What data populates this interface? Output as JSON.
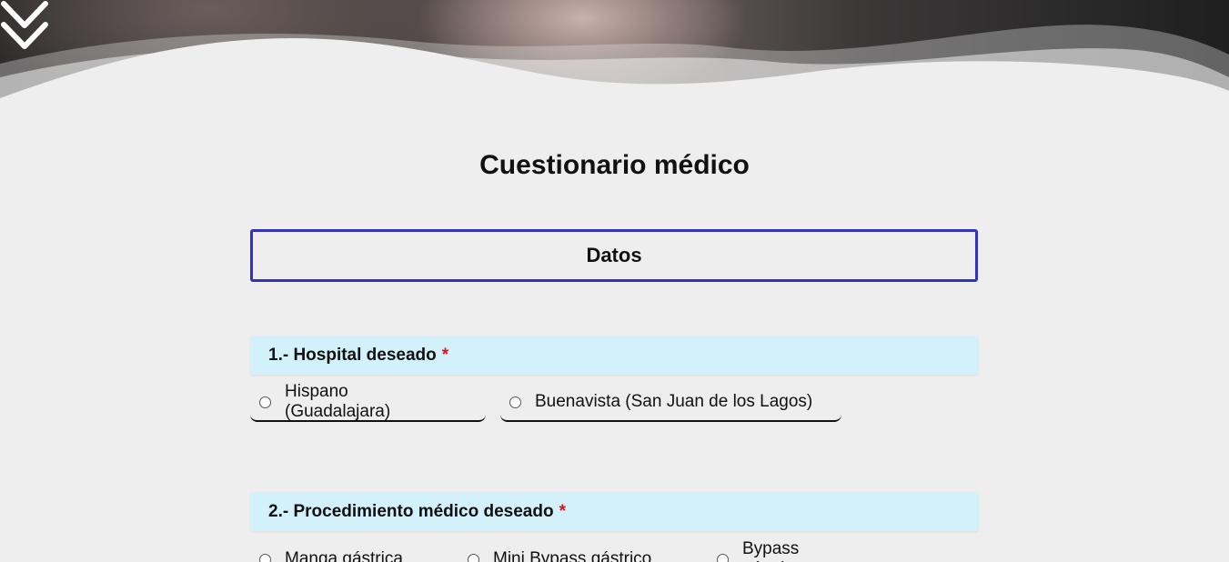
{
  "page": {
    "title": "Cuestionario médico"
  },
  "hero": {
    "scroll_icon": "double-chevron-down-icon"
  },
  "section": {
    "label": "Datos"
  },
  "questions": [
    {
      "label": "1.- Hospital deseado",
      "required_mark": "*",
      "options": [
        "Hispano (Guadalajara)",
        "Buenavista (San Juan de los Lagos)"
      ]
    },
    {
      "label": "2.- Procedimiento médico deseado",
      "required_mark": "*",
      "options": [
        "Manga gástrica",
        "Mini Bypass gástrico",
        "Bypass gástrico"
      ]
    }
  ],
  "colors": {
    "section_border": "#3333bb",
    "question_header_bg": "#d3f1fb",
    "required": "#e01010",
    "page_bg": "#eeeeee"
  }
}
